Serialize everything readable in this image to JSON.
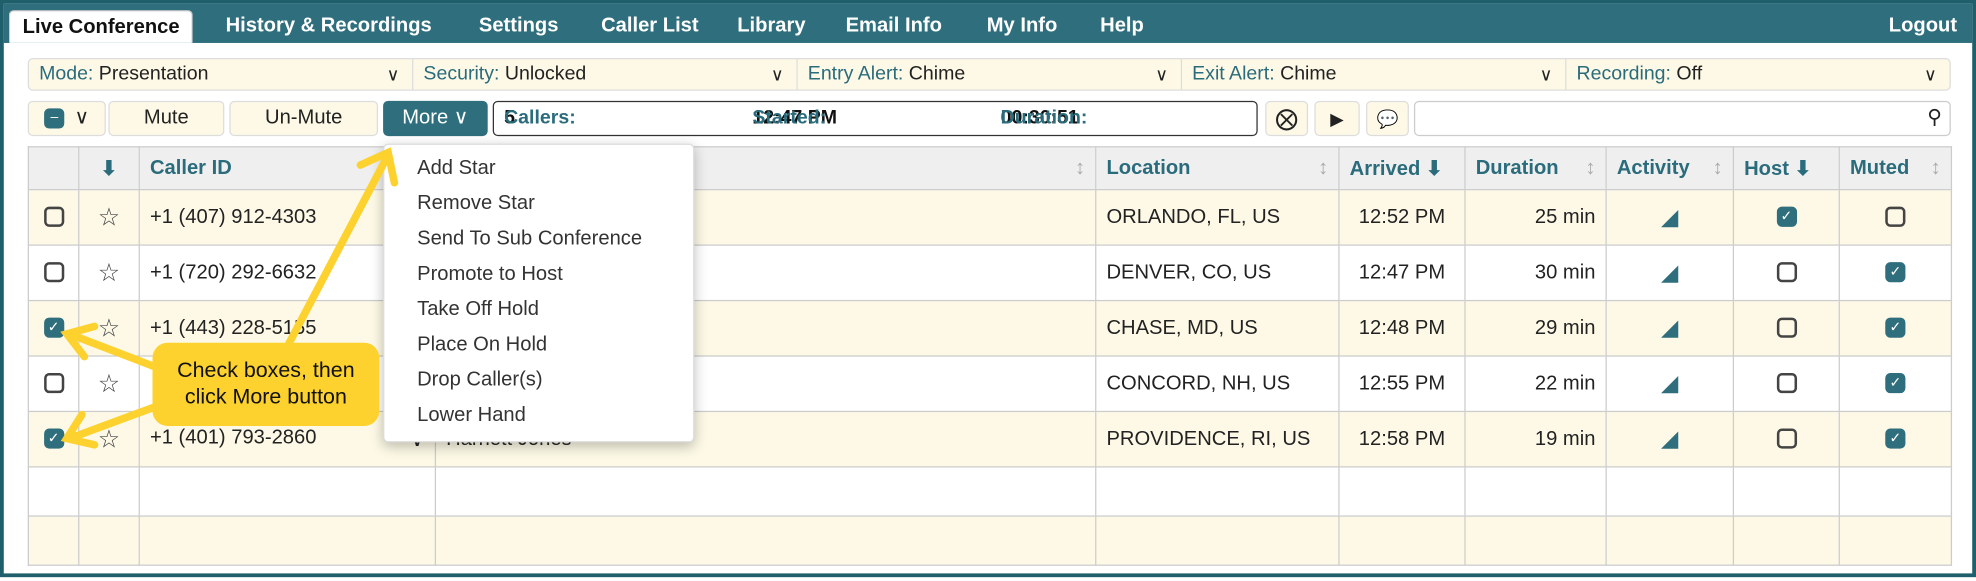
{
  "tabs": [
    "Live Conference",
    "History & Recordings",
    "Settings",
    "Caller List",
    "Library",
    "Email Info",
    "My Info",
    "Help"
  ],
  "logout": "Logout",
  "selects": [
    {
      "key": "Mode:",
      "value": "Presentation"
    },
    {
      "key": "Security:",
      "value": "Unlocked"
    },
    {
      "key": "Entry Alert:",
      "value": "Chime"
    },
    {
      "key": "Exit Alert:",
      "value": "Chime"
    },
    {
      "key": "Recording:",
      "value": "Off"
    }
  ],
  "toolbar": {
    "mute": "Mute",
    "unmute": "Un-Mute",
    "more": "More",
    "search_value": ""
  },
  "info": {
    "callers_label": "Callers:",
    "callers": "5",
    "started_label": "Started:",
    "started": "12:47 PM",
    "duration_label": "Duration:",
    "duration": "00:30:51"
  },
  "columns": [
    "Caller ID",
    "Location",
    "Arrived",
    "Duration",
    "Activity",
    "Host",
    "Muted"
  ],
  "rows": [
    {
      "checked": false,
      "caller_id": "+1 (407) 912-4303",
      "name": "",
      "location": "ORLANDO, FL, US",
      "arrived": "12:52 PM",
      "duration": "25 min",
      "host": true,
      "muted": false
    },
    {
      "checked": false,
      "caller_id": "+1 (720) 292-6632",
      "name": "",
      "location": "DENVER, CO, US",
      "arrived": "12:47 PM",
      "duration": "30 min",
      "host": false,
      "muted": true
    },
    {
      "checked": true,
      "caller_id": "+1 (443) 228-5155",
      "name": "",
      "location": "CHASE, MD, US",
      "arrived": "12:48 PM",
      "duration": "29 min",
      "host": false,
      "muted": true
    },
    {
      "checked": false,
      "caller_id": "",
      "name": "",
      "location": "CONCORD, NH, US",
      "arrived": "12:55 PM",
      "duration": "22 min",
      "host": false,
      "muted": true
    },
    {
      "checked": true,
      "caller_id": "+1 (401) 793-2860",
      "name": "Harriett Jones",
      "location": "PROVIDENCE, RI, US",
      "arrived": "12:58 PM",
      "duration": "19 min",
      "host": false,
      "muted": true
    }
  ],
  "menu": [
    "Add Star",
    "Remove Star",
    "Send To Sub Conference",
    "Promote to Host",
    "Take Off Hold",
    "Place On Hold",
    "Drop Caller(s)",
    "Lower Hand"
  ],
  "callout": [
    "Check boxes, then",
    "click More button"
  ],
  "colors": {
    "brand": "#2f6f7d",
    "cream": "#fdf9e6",
    "annotation": "#fdd22e"
  }
}
